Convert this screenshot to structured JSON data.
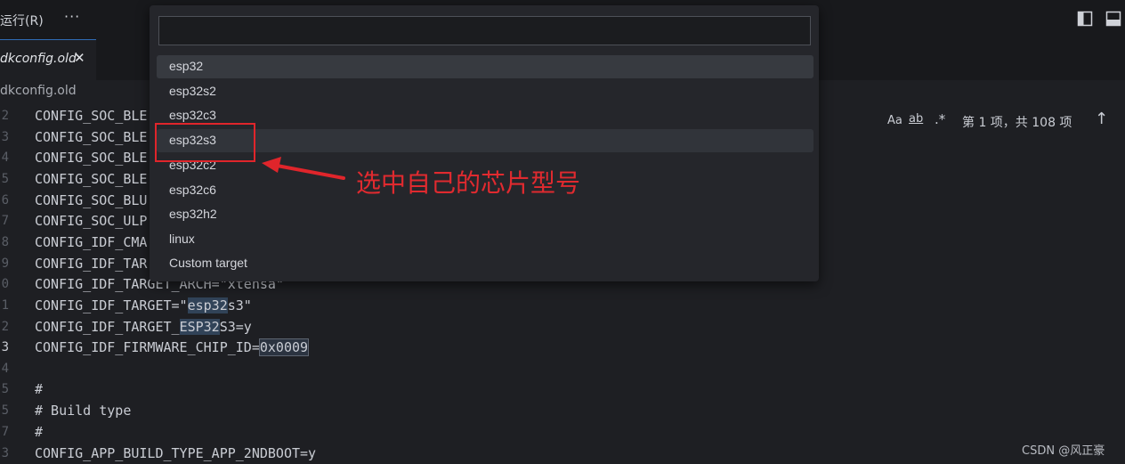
{
  "titlebar": {
    "menu_run": "运行(R)",
    "more": "···"
  },
  "tab": {
    "title": "dkconfig.old",
    "close": "✕"
  },
  "breadcrumb": "dkconfig.old",
  "editor": {
    "lines": [
      {
        "num": "2",
        "text": "CONFIG_SOC_BLE"
      },
      {
        "num": "3",
        "text": "CONFIG_SOC_BLE"
      },
      {
        "num": "4",
        "text": "CONFIG_SOC_BLE"
      },
      {
        "num": "5",
        "text": "CONFIG_SOC_BLE"
      },
      {
        "num": "6",
        "text": "CONFIG_SOC_BLU"
      },
      {
        "num": "7",
        "text": "CONFIG_SOC_ULP"
      },
      {
        "num": "8",
        "text": "CONFIG_IDF_CMA"
      },
      {
        "num": "9",
        "text": "CONFIG_IDF_TAR"
      },
      {
        "num": "0",
        "text": "CONFIG_IDF_TARGET_ARCH=\"xtensa\""
      },
      {
        "num": "1",
        "pre": "CONFIG_IDF_TARGET=\"",
        "match": "esp32",
        "post": "s3\""
      },
      {
        "num": "2",
        "pre": "CONFIG_IDF_TARGET_",
        "match": "ESP32",
        "post": "S3=y"
      },
      {
        "num": "3",
        "pre": "CONFIG_IDF_FIRMWARE_CHIP_ID=",
        "box": "0x0009",
        "post": ""
      },
      {
        "num": "4",
        "text": ""
      },
      {
        "num": "5",
        "text": "#"
      },
      {
        "num": "5",
        "text": "# Build type"
      },
      {
        "num": "7",
        "text": "#"
      },
      {
        "num": "3",
        "text": "CONFIG_APP_BUILD_TYPE_APP_2NDBOOT=y"
      }
    ]
  },
  "find": {
    "match_case": "Aa",
    "whole_word": "ab",
    "regex": ".*",
    "count": "第 1 项，共 108 项",
    "up": "↑"
  },
  "quickpick": {
    "input_value": "",
    "items": [
      "esp32",
      "esp32s2",
      "esp32c3",
      "esp32s3",
      "esp32c2",
      "esp32c6",
      "esp32h2",
      "linux",
      "Custom target"
    ]
  },
  "annotation": {
    "text": "选中自己的芯片型号",
    "color": "#e0252b"
  },
  "watermark": "CSDN @风正豪"
}
